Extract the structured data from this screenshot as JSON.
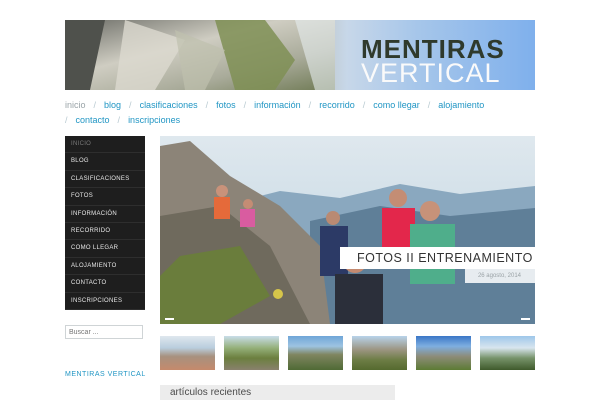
{
  "header": {
    "title_line1": "MENTIRAS",
    "title_line2": "VERTICAL"
  },
  "topnav": {
    "items": [
      "inicio",
      "blog",
      "clasificaciones",
      "fotos",
      "información",
      "recorrido",
      "como llegar",
      "alojamiento",
      "contacto",
      "inscripciones"
    ]
  },
  "sidebar": {
    "items": [
      "INICIO",
      "BLOG",
      "CLASIFICACIONES",
      "FOTOS",
      "INFORMACIÓN",
      "RECORRIDO",
      "COMO LLEGAR",
      "ALOJAMIENTO",
      "CONTACTO",
      "INSCRIPCIONES"
    ],
    "search_placeholder": "Buscar ...",
    "widget_title": "MENTIRAS VERTICAL"
  },
  "slider": {
    "caption": "FOTOS II ENTRENAMIENTO",
    "date": "26 agosto, 2014"
  },
  "recent_posts_title": "artículos recientes",
  "colors": {
    "link": "#2196c4",
    "menu_bg": "#1e1e1e"
  }
}
